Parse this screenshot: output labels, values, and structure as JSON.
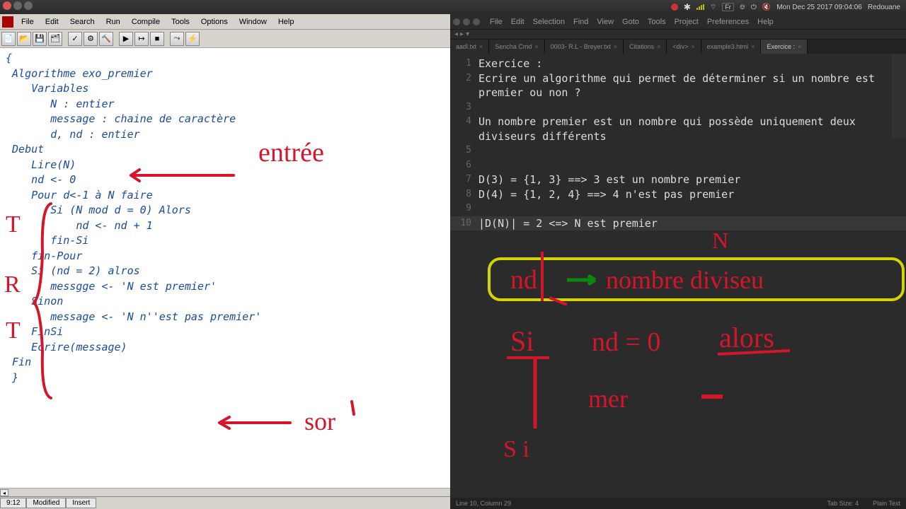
{
  "sysbar": {
    "kbd": "Fr",
    "datetime": "Mon Dec 25 2017 09:04:06",
    "user": "Redouane"
  },
  "left": {
    "menu": [
      "File",
      "Edit",
      "Search",
      "Run",
      "Compile",
      "Tools",
      "Options",
      "Window",
      "Help"
    ],
    "code": [
      "{",
      " Algorithme exo_premier",
      "    Variables",
      "       N : entier",
      "       message : chaine de caractère",
      "",
      "       d, nd : entier",
      " Debut",
      "    Lire(N)",
      "",
      "    nd <- 0",
      "    Pour d<-1 à N faire",
      "       Si (N mod d = 0) Alors",
      "           nd <- nd + 1",
      "       fin-Si",
      "    fin-Pour",
      "",
      "    Si (nd = 2) alros",
      "       messgge <- 'N est premier'",
      "    Sinon",
      "       message <- 'N n''est pas premier'",
      "    FinSi",
      "",
      "",
      "    Ecrire(message)",
      " Fin",
      "",
      " }"
    ],
    "status": {
      "pos": "9:12",
      "mod": "Modified",
      "mode": "Insert"
    }
  },
  "right": {
    "menu": [
      "File",
      "Edit",
      "Selection",
      "Find",
      "View",
      "Goto",
      "Tools",
      "Project",
      "Preferences",
      "Help"
    ],
    "tabs": [
      {
        "label": "aadl.txt",
        "active": false
      },
      {
        "label": "Sencha Cmd",
        "active": false
      },
      {
        "label": "0003- R.L - Breyer.txt",
        "active": false
      },
      {
        "label": "Citations",
        "active": false
      },
      {
        "label": "<div>",
        "active": false
      },
      {
        "label": "example3.html",
        "active": false
      },
      {
        "label": "Exercice :",
        "active": true
      }
    ],
    "lines": [
      {
        "n": 1,
        "t": "Exercice :"
      },
      {
        "n": 2,
        "t": "Ecrire un algorithme qui permet de déterminer si un nombre est premier ou non ?"
      },
      {
        "n": 3,
        "t": ""
      },
      {
        "n": 4,
        "t": "Un nombre premier est un nombre qui possède uniquement deux diviseurs différents"
      },
      {
        "n": 5,
        "t": ""
      },
      {
        "n": 6,
        "t": ""
      },
      {
        "n": 7,
        "t": "D(3) = {1, 3} ==> 3 est un nombre premier"
      },
      {
        "n": 8,
        "t": "D(4) = {1, 2, 4} ==> 4 n'est pas premier"
      },
      {
        "n": 9,
        "t": ""
      },
      {
        "n": 10,
        "t": "|D(N)| = 2 <=> N est premier"
      }
    ],
    "status": {
      "left": "Line 10, Column 29",
      "tabsize": "Tab Size: 4",
      "syntax": "Plain Text"
    }
  },
  "annotations": {
    "entree": "entrée",
    "sor": "sor",
    "left_letters": [
      "T",
      "R",
      "T"
    ],
    "nd": "nd",
    "nombre": "nombre diviseu",
    "si": "Si",
    "ndeq": "nd = 0",
    "alors": "alors",
    "mer": "mer",
    "N": "N"
  }
}
